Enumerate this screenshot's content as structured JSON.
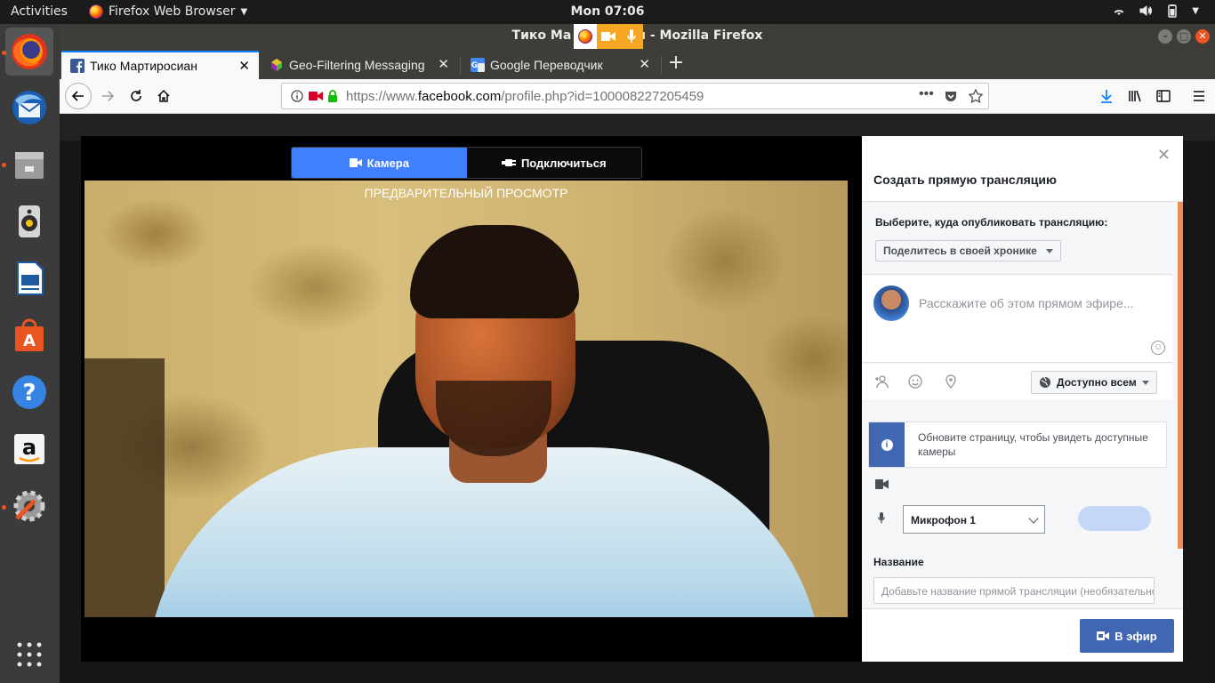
{
  "topbar": {
    "activities": "Activities",
    "app_menu": "Firefox Web Browser",
    "clock": "Mon 07:06",
    "tray_icons": [
      "wifi-icon",
      "volume-icon",
      "battery-icon",
      "power-menu-icon"
    ]
  },
  "dock": {
    "apps": [
      "firefox",
      "thunderbird",
      "files",
      "rhythmbox",
      "libreoffice-writer",
      "ubuntu-software",
      "help",
      "amazon",
      "settings",
      "show-applications"
    ]
  },
  "window": {
    "title": "Тико Мартиросиан - Mozilla Firefox",
    "title_visible_left": "Тико Ма",
    "title_visible_right": "н - Mozilla Firefox"
  },
  "tabs": [
    {
      "label": "Тико Мартиросиан",
      "favicon": "facebook-icon",
      "selected": true
    },
    {
      "label": "Geo-Filtering Messaging",
      "favicon": "geo-filter-icon",
      "selected": false
    },
    {
      "label": "Google Переводчик",
      "favicon": "google-translate-icon",
      "selected": false
    }
  ],
  "navbar": {
    "url_prefix": "https://www.",
    "url_domain": "facebook.com",
    "url_path": "/profile.php?id=100008227205459"
  },
  "live": {
    "tab_camera": "Камера",
    "tab_connect": "Подключиться",
    "preview_label": "ПРЕДВАРИТЕЛЬНЫЙ ПРОСМОТР",
    "panel_title": "Создать прямую трансляцию",
    "where_label": "Выберите, куда опубликовать трансляцию:",
    "where_value": "Поделитесь в своей хронике",
    "composer_placeholder": "Расскажите об этом прямом эфире...",
    "audience": "Доступно всем",
    "info_message": "Обновите страницу, чтобы увидеть доступные камеры",
    "mic_value": "Микрофон 1",
    "name_label": "Название",
    "name_placeholder": "Добавьте название прямой трансляции (необязательно)",
    "go_live": "В эфир",
    "colors": {
      "accent": "#4080ff",
      "fb_blue": "#4267b2",
      "scroll": "#f08a55"
    }
  }
}
